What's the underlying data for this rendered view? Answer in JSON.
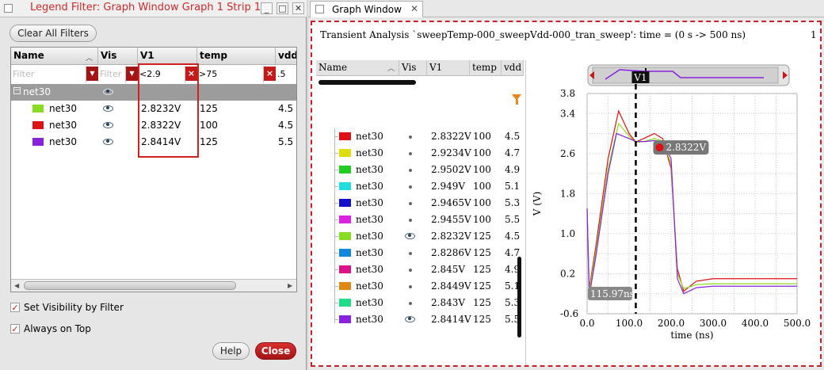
{
  "dialog": {
    "title": "Legend Filter: Graph Window Graph 1 Strip 1",
    "clear_all_label": "Clear All Filters",
    "columns": [
      "Name",
      "Vis",
      "V1",
      "temp",
      "vdd"
    ],
    "filters": {
      "name_placeholder": "Filter",
      "vis_placeholder": "Filter",
      "v1_value": "<2.9",
      "temp_value": ">75",
      "vdd_value": ".5"
    },
    "group_label": "net30",
    "rows": [
      {
        "name": "net30",
        "v1": "2.8232V",
        "temp": "125",
        "vdd": "4.5",
        "color": "#88dd22"
      },
      {
        "name": "net30",
        "v1": "2.8322V",
        "temp": "100",
        "vdd": "4.5",
        "color": "#dd1111"
      },
      {
        "name": "net30",
        "v1": "2.8414V",
        "temp": "125",
        "vdd": "5.5",
        "color": "#8822dd"
      }
    ],
    "set_visibility_label": "Set Visibility by Filter",
    "always_on_top_label": "Always on Top",
    "help_label": "Help",
    "close_label": "Close"
  },
  "graph": {
    "tab_label": "Graph Window",
    "plot_title": "Transient Analysis `sweepTemp-000_sweepVdd-000_tran_sweep': time = (0 s -> 500 ns)",
    "strip_number": "1",
    "legend_columns": [
      "Name",
      "Vis",
      "V1",
      "temp",
      "vdd"
    ],
    "legend_rows": [
      {
        "name": "net30",
        "visible": false,
        "v1": "2.8322V",
        "temp": "100",
        "vdd": "4.5",
        "color": "#dd1111"
      },
      {
        "name": "net30",
        "visible": false,
        "v1": "2.9234V",
        "temp": "100",
        "vdd": "4.7",
        "color": "#dddd11"
      },
      {
        "name": "net30",
        "visible": false,
        "v1": "2.9502V",
        "temp": "100",
        "vdd": "4.9",
        "color": "#22cc22"
      },
      {
        "name": "net30",
        "visible": false,
        "v1": "2.949V",
        "temp": "100",
        "vdd": "5.1",
        "color": "#22dddd"
      },
      {
        "name": "net30",
        "visible": false,
        "v1": "2.9465V",
        "temp": "100",
        "vdd": "5.3",
        "color": "#1111cc"
      },
      {
        "name": "net30",
        "visible": false,
        "v1": "2.9455V",
        "temp": "100",
        "vdd": "5.5",
        "color": "#dd22dd"
      },
      {
        "name": "net30",
        "visible": true,
        "v1": "2.8232V",
        "temp": "125",
        "vdd": "4.5",
        "color": "#88dd22"
      },
      {
        "name": "net30",
        "visible": false,
        "v1": "2.8286V",
        "temp": "125",
        "vdd": "4.7",
        "color": "#1188dd"
      },
      {
        "name": "net30",
        "visible": false,
        "v1": "2.845V",
        "temp": "125",
        "vdd": "4.9",
        "color": "#dd1188"
      },
      {
        "name": "net30",
        "visible": false,
        "v1": "2.8449V",
        "temp": "125",
        "vdd": "5.1",
        "color": "#dd8811"
      },
      {
        "name": "net30",
        "visible": false,
        "v1": "2.843V",
        "temp": "125",
        "vdd": "5.3",
        "color": "#22dd88"
      },
      {
        "name": "net30",
        "visible": true,
        "v1": "2.8414V",
        "temp": "125",
        "vdd": "5.5",
        "color": "#8822dd"
      }
    ]
  },
  "chart_data": {
    "type": "line",
    "xlabel": "time (ns)",
    "ylabel": "V (V)",
    "xlim": [
      0,
      500
    ],
    "ylim": [
      -0.6,
      3.8
    ],
    "x_ticks": [
      "0.0",
      "100.0",
      "200.0",
      "300.0",
      "400.0",
      "500.0"
    ],
    "y_ticks": [
      "3.8",
      "3.4",
      "2.6",
      "1.8",
      "1.0",
      "0.2",
      "-0.6"
    ],
    "grid": true,
    "cursor": {
      "label": "V1",
      "x": 115.97,
      "x_readout": "115.97ns",
      "marker_value": "2.8322V",
      "marker_y": 2.8322
    },
    "series": [
      {
        "color": "#dd1111",
        "x": [
          0,
          5,
          20,
          50,
          75,
          100,
          116,
          140,
          160,
          180,
          200,
          215,
          230,
          260,
          300,
          500
        ],
        "y": [
          1.5,
          -0.1,
          0.7,
          2.5,
          3.45,
          3.0,
          2.83,
          2.92,
          3.0,
          2.9,
          2.3,
          0.3,
          -0.15,
          0.05,
          0.1,
          0.1
        ]
      },
      {
        "color": "#88dd22",
        "x": [
          0,
          5,
          20,
          50,
          75,
          100,
          116,
          140,
          160,
          180,
          200,
          215,
          230,
          260,
          300,
          500
        ],
        "y": [
          1.5,
          -0.15,
          0.6,
          2.3,
          3.2,
          2.95,
          2.82,
          2.85,
          2.9,
          2.85,
          2.4,
          0.2,
          -0.1,
          -0.02,
          0.0,
          0.0
        ]
      },
      {
        "color": "#8822dd",
        "x": [
          0,
          5,
          20,
          50,
          70,
          100,
          116,
          140,
          160,
          180,
          200,
          215,
          230,
          260,
          300,
          500
        ],
        "y": [
          1.5,
          -0.25,
          0.5,
          2.2,
          3.0,
          2.9,
          2.84,
          2.84,
          2.86,
          2.84,
          2.5,
          0.1,
          -0.2,
          -0.08,
          -0.05,
          -0.05
        ]
      }
    ]
  }
}
